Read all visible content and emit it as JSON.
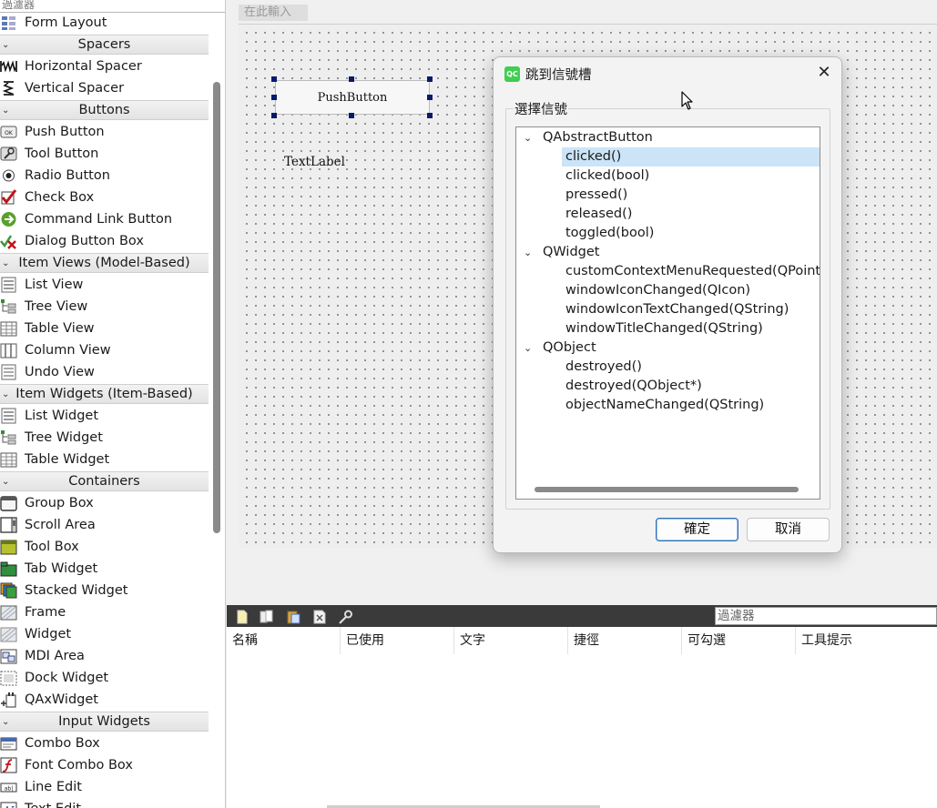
{
  "widget_box": {
    "filter_label": "過濾器",
    "sections": [
      {
        "type": "item",
        "label": "Form Layout",
        "icon": "form-layout-icon"
      },
      {
        "type": "category",
        "label": "Spacers"
      },
      {
        "type": "item",
        "label": "Horizontal Spacer",
        "icon": "horizontal-spacer-icon"
      },
      {
        "type": "item",
        "label": "Vertical Spacer",
        "icon": "vertical-spacer-icon"
      },
      {
        "type": "category",
        "label": "Buttons"
      },
      {
        "type": "item",
        "label": "Push Button",
        "icon": "push-button-icon"
      },
      {
        "type": "item",
        "label": "Tool Button",
        "icon": "tool-button-icon"
      },
      {
        "type": "item",
        "label": "Radio Button",
        "icon": "radio-button-icon"
      },
      {
        "type": "item",
        "label": "Check Box",
        "icon": "check-box-icon"
      },
      {
        "type": "item",
        "label": "Command Link Button",
        "icon": "command-link-icon"
      },
      {
        "type": "item",
        "label": "Dialog Button Box",
        "icon": "dialog-button-box-icon"
      },
      {
        "type": "category",
        "label": "Item Views (Model-Based)"
      },
      {
        "type": "item",
        "label": "List View",
        "icon": "list-view-icon"
      },
      {
        "type": "item",
        "label": "Tree View",
        "icon": "tree-view-icon"
      },
      {
        "type": "item",
        "label": "Table View",
        "icon": "table-view-icon"
      },
      {
        "type": "item",
        "label": "Column View",
        "icon": "column-view-icon"
      },
      {
        "type": "item",
        "label": "Undo View",
        "icon": "undo-view-icon"
      },
      {
        "type": "category",
        "label": "Item Widgets (Item-Based)"
      },
      {
        "type": "item",
        "label": "List Widget",
        "icon": "list-widget-icon"
      },
      {
        "type": "item",
        "label": "Tree Widget",
        "icon": "tree-widget-icon"
      },
      {
        "type": "item",
        "label": "Table Widget",
        "icon": "table-widget-icon"
      },
      {
        "type": "category",
        "label": "Containers"
      },
      {
        "type": "item",
        "label": "Group Box",
        "icon": "group-box-icon"
      },
      {
        "type": "item",
        "label": "Scroll Area",
        "icon": "scroll-area-icon"
      },
      {
        "type": "item",
        "label": "Tool Box",
        "icon": "tool-box-icon"
      },
      {
        "type": "item",
        "label": "Tab Widget",
        "icon": "tab-widget-icon"
      },
      {
        "type": "item",
        "label": "Stacked Widget",
        "icon": "stacked-widget-icon"
      },
      {
        "type": "item",
        "label": "Frame",
        "icon": "frame-icon"
      },
      {
        "type": "item",
        "label": "Widget",
        "icon": "widget-icon"
      },
      {
        "type": "item",
        "label": "MDI Area",
        "icon": "mdi-area-icon"
      },
      {
        "type": "item",
        "label": "Dock Widget",
        "icon": "dock-widget-icon"
      },
      {
        "type": "item",
        "label": "QAxWidget",
        "icon": "qaxwidget-icon"
      },
      {
        "type": "category",
        "label": "Input Widgets"
      },
      {
        "type": "item",
        "label": "Combo Box",
        "icon": "combo-box-icon"
      },
      {
        "type": "item",
        "label": "Font Combo Box",
        "icon": "font-combo-box-icon"
      },
      {
        "type": "item",
        "label": "Line Edit",
        "icon": "line-edit-icon"
      },
      {
        "type": "item",
        "label": "Text Edit",
        "icon": "text-edit-icon"
      }
    ]
  },
  "form": {
    "title_placeholder": "在此輸入",
    "push_button_text": "PushButton",
    "text_label_text": "TextLabel"
  },
  "dialog": {
    "title": "跳到信號槽",
    "app_icon_text": "QC",
    "close_glyph": "✕",
    "group_label": "選擇信號",
    "tree": [
      {
        "label": "QAbstractButton",
        "children": [
          "clicked()",
          "clicked(bool)",
          "pressed()",
          "released()",
          "toggled(bool)"
        ]
      },
      {
        "label": "QWidget",
        "children": [
          "customContextMenuRequested(QPoint)",
          "windowIconChanged(QIcon)",
          "windowIconTextChanged(QString)",
          "windowTitleChanged(QString)"
        ]
      },
      {
        "label": "QObject",
        "children": [
          "destroyed()",
          "destroyed(QObject*)",
          "objectNameChanged(QString)"
        ]
      }
    ],
    "selected": "clicked()",
    "ok_label": "確定",
    "cancel_label": "取消"
  },
  "action_editor": {
    "filter_label": "過濾器",
    "toolbar_icons": [
      "new-action-icon",
      "copy-action-icon",
      "paste-action-icon",
      "delete-action-icon",
      "configure-icon"
    ],
    "columns": [
      "名稱",
      "已使用",
      "文字",
      "捷徑",
      "可勾選",
      "工具提示"
    ]
  },
  "colors": {
    "selection": "#cce4f7",
    "default_button_border": "#2f6fb7",
    "handle": "#0a1a6a",
    "toolbar_bg": "#3a3a3a"
  }
}
